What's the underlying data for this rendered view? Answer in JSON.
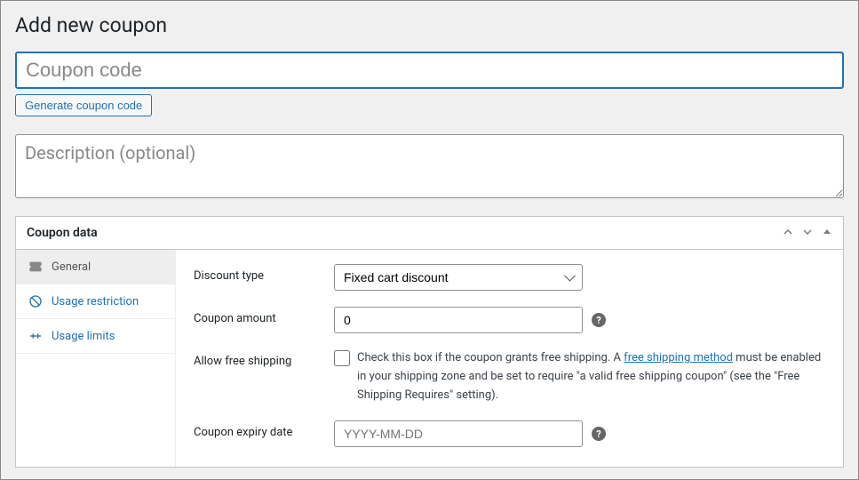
{
  "page_title": "Add new coupon",
  "coupon_code": {
    "placeholder": "Coupon code",
    "value": ""
  },
  "generate_btn_label": "Generate coupon code",
  "description": {
    "placeholder": "Description (optional)",
    "value": ""
  },
  "panel": {
    "title": "Coupon data",
    "tabs": [
      {
        "label": "General",
        "active": true
      },
      {
        "label": "Usage restriction",
        "active": false
      },
      {
        "label": "Usage limits",
        "active": false
      }
    ]
  },
  "form": {
    "discount_type": {
      "label": "Discount type",
      "selected": "Fixed cart discount"
    },
    "coupon_amount": {
      "label": "Coupon amount",
      "value": "0"
    },
    "free_shipping": {
      "label": "Allow free shipping",
      "text_before": "Check this box if the coupon grants free shipping. A ",
      "link_text": "free shipping method",
      "text_after": " must be enabled in your shipping zone and be set to require \"a valid free shipping coupon\" (see the \"Free Shipping Requires\" setting)."
    },
    "expiry": {
      "label": "Coupon expiry date",
      "placeholder": "YYYY-MM-DD",
      "value": ""
    }
  }
}
